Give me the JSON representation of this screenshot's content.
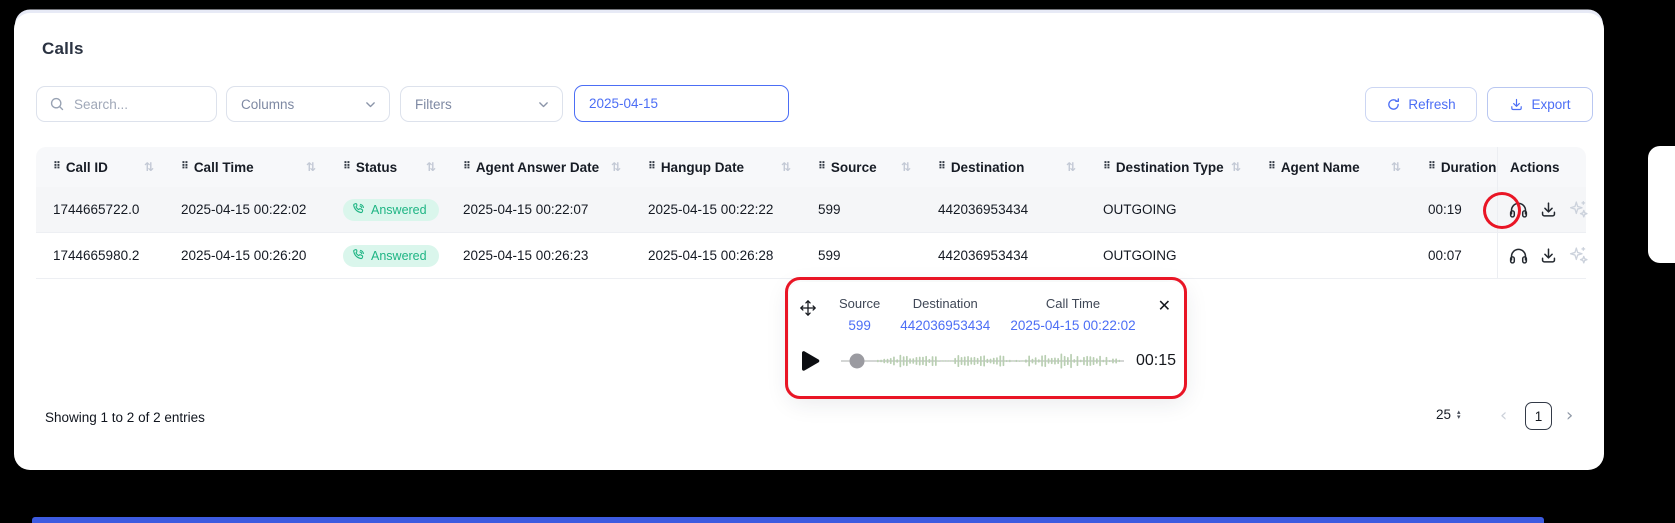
{
  "page": {
    "title": "Calls"
  },
  "toolbar": {
    "search_placeholder": "Search...",
    "columns_label": "Columns",
    "filters_label": "Filters",
    "date_value": "2025-04-15",
    "refresh_label": "Refresh",
    "export_label": "Export"
  },
  "table": {
    "columns": [
      "Call ID",
      "Call Time",
      "Status",
      "Agent Answer Date",
      "Hangup Date",
      "Source",
      "Destination",
      "Destination Type",
      "Agent Name",
      "Duration",
      "Actions"
    ],
    "rows": [
      {
        "call_id": "1744665722.0",
        "call_time": "2025-04-15 00:22:02",
        "status": "Answered",
        "agent_answer_date": "2025-04-15 00:22:07",
        "hangup_date": "2025-04-15 00:22:22",
        "source": "599",
        "destination": "442036953434",
        "destination_type": "OUTGOING",
        "agent_name": "",
        "duration": "00:19"
      },
      {
        "call_id": "1744665980.2",
        "call_time": "2025-04-15 00:26:20",
        "status": "Answered",
        "agent_answer_date": "2025-04-15 00:26:23",
        "hangup_date": "2025-04-15 00:26:28",
        "source": "599",
        "destination": "442036953434",
        "destination_type": "OUTGOING",
        "agent_name": "",
        "duration": "00:07"
      }
    ]
  },
  "player": {
    "source_label": "Source",
    "source_value": "599",
    "destination_label": "Destination",
    "destination_value": "442036953434",
    "call_time_label": "Call Time",
    "call_time_value": "2025-04-15 00:22:02",
    "elapsed": "00:15"
  },
  "footer": {
    "showing_text": "Showing 1 to 2 of 2 entries",
    "page_size": "25",
    "current_page": "1"
  },
  "icons": {
    "drag_handle": "⠿",
    "sort": "⇅",
    "close": "✕",
    "prev": "‹",
    "next": "›",
    "step_up": "▴",
    "step_down": "▾"
  },
  "colors": {
    "accent": "#4c6ef5",
    "status_text": "#1fb584",
    "status_bg": "#daf6ec",
    "annotation_red": "#e91525",
    "waveform": "#b9cfb2"
  }
}
